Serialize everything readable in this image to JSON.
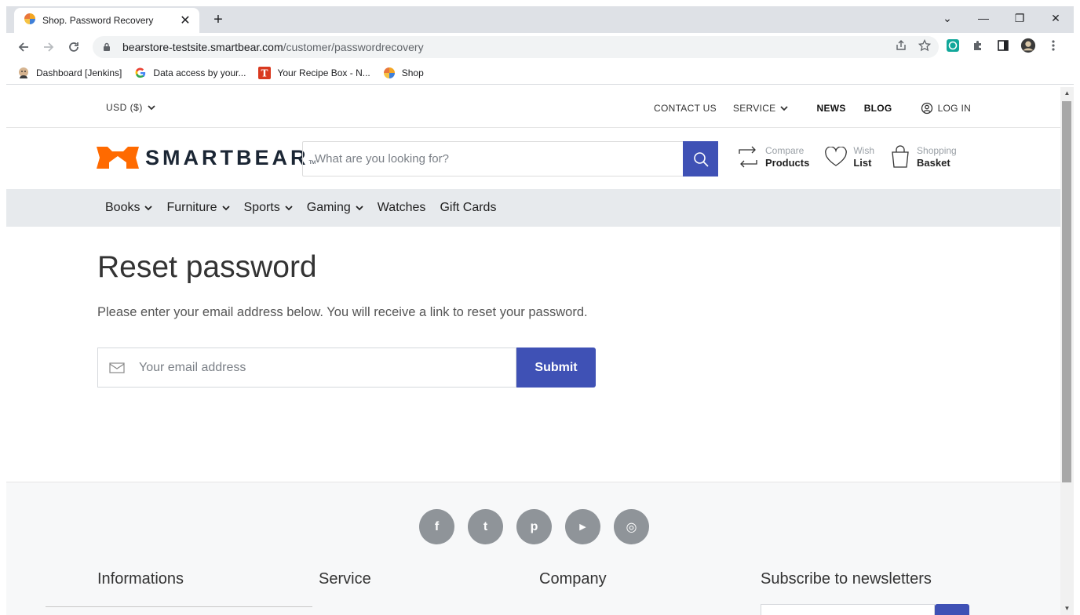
{
  "browser": {
    "tab_title": "Shop. Password Recovery",
    "tab_close": "✕",
    "new_tab": "+",
    "url_host": "bearstore-testsite.smartbear.com",
    "url_path": "/customer/passwordrecovery",
    "window_controls": [
      "⌄",
      "—",
      "❐",
      "✕"
    ],
    "bookmarks": [
      {
        "label": "Dashboard [Jenkins]",
        "icon": "jenkins-icon"
      },
      {
        "label": "Data access by your...",
        "icon": "google-icon"
      },
      {
        "label": "Your Recipe Box - N...",
        "icon": "nytimes-icon"
      },
      {
        "label": "Shop",
        "icon": "shop-icon"
      }
    ]
  },
  "topbar": {
    "currency": "USD  ($)",
    "contact": "CONTACT US",
    "service": "SERVICE",
    "news": "NEWS",
    "blog": "BLOG",
    "login": "LOG IN"
  },
  "header": {
    "logo_text": "SMARTBEAR",
    "logo_tm": "TM",
    "search_placeholder": "What are you looking for?",
    "compare_line1": "Compare",
    "compare_line2": "Products",
    "wish_line1": "Wish",
    "wish_line2": "List",
    "basket_line1": "Shopping",
    "basket_line2": "Basket",
    "accent_color": "#3f51b5"
  },
  "menu": {
    "items": [
      {
        "label": "Books",
        "has_dropdown": true
      },
      {
        "label": "Furniture",
        "has_dropdown": true
      },
      {
        "label": "Sports",
        "has_dropdown": true
      },
      {
        "label": "Gaming",
        "has_dropdown": true
      },
      {
        "label": "Watches",
        "has_dropdown": false
      },
      {
        "label": "Gift Cards",
        "has_dropdown": false
      }
    ]
  },
  "main": {
    "title": "Reset password",
    "description": "Please enter your email address below. You will receive a link to reset your password.",
    "email_placeholder": "Your email address",
    "submit_label": "Submit"
  },
  "footer": {
    "socials": [
      "f",
      "t",
      "p",
      "▶",
      "◎"
    ],
    "headings": [
      "Informations",
      "Service",
      "Company",
      "Subscribe to newsletters"
    ]
  }
}
